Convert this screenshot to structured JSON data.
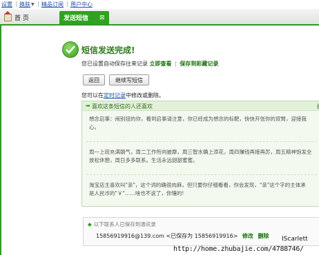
{
  "top_menu": {
    "settings": "设置",
    "skin": "换肤",
    "skin_caret": "▼",
    "sep": "|",
    "premium": "精品订阅",
    "user_center": "用户中心"
  },
  "tabs": {
    "home": "首 页",
    "active": "发送短信",
    "close": "⊠"
  },
  "result": {
    "title": "短信发送完成!",
    "auto_save_text": "您已设置自动保存往来记录",
    "view_now": "立即查看",
    "save_to_favorites": "保存到彩藏记录",
    "sep": "|"
  },
  "buttons": {
    "back": "返回",
    "continue": "继续写短信"
  },
  "modify_note": {
    "prefix": "您可以在",
    "link": "定时记录",
    "suffix": "中修改或删除。"
  },
  "message": {
    "header_arrow": "➡",
    "header_title": "喜欢这条短信的人还喜欢",
    "header_right": "换",
    "para1_line1": "想念启事：闹别扭的你，看到启事请注意，你已经成为想念的标靶，快快开张你的双臂，迎接我",
    "para1_line2": "心。",
    "para2_line1": "周一上班充满朝气，周二工作所向披靡，周三智水确上添花，周四赚钱再接再厉，周五精神饱发全",
    "para2_line2": "放松休憩，周日多多联系。生活永远甜甜蜜蜜。",
    "para3_line1": "淘宝店主喜欢叫\"亲\"，这个词的确很肉麻，但只要你仔细看看，你会发现，\"亲\"这个字的主体承",
    "para3_line2": "是人民币的\"￥\"……啥也不说了，你懂的!"
  },
  "contacts": {
    "header": "以下联系人已保存到通讯录",
    "dot": "◆",
    "email": "15856919916@139.com",
    "saved_as": "<已保存为 15856919916>",
    "edit": "修改",
    "delete": "删除"
  },
  "watermark": {
    "name": "IScarlett",
    "url": "http://home.zhubajie.com/4788746/"
  },
  "colors": {
    "accent_green": "#2f9a23",
    "link_blue": "#1c4fa8"
  }
}
